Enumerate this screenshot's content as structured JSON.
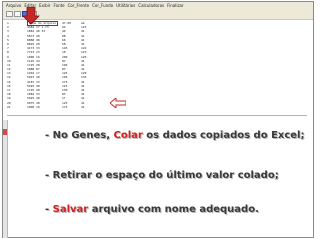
{
  "menu": [
    "Arquivo",
    "Editar",
    "Exibir",
    "Fonte",
    "Cor_Frente",
    "Cor_Fundo",
    "Utilitários",
    "Calculadoras",
    "Finalizar"
  ],
  "rows": [
    [
      "1",
      "Nome do arquivo",
      "47.00",
      "ab"
    ],
    [
      "2",
      "4382 17 1.73",
      "62",
      "123"
    ],
    [
      "3",
      "1882 40 33",
      "49",
      "41"
    ],
    [
      "4",
      "5873 40",
      "88",
      "41"
    ],
    [
      "5",
      "8888 40",
      "66",
      "41"
    ],
    [
      "6",
      "8825 28",
      "58",
      "41"
    ],
    [
      "7",
      "4173 33",
      "145",
      "122"
    ],
    [
      "8",
      "7723 23",
      "18",
      "123"
    ],
    [
      "9",
      "1000 16",
      "200",
      "126"
    ],
    [
      "10",
      "1125 44",
      "87",
      "41"
    ],
    [
      "11",
      "1725 28",
      "196",
      "41"
    ],
    [
      "12",
      "1888 87",
      "83",
      "41"
    ],
    [
      "13",
      "1204 17",
      "125",
      "120"
    ],
    [
      "14",
      "5923 40",
      "196",
      "135"
    ],
    [
      "15",
      "4187 33",
      "175",
      "41"
    ],
    [
      "16",
      "5925 40",
      "125",
      "41"
    ],
    [
      "17",
      "1725 28",
      "130",
      "41"
    ],
    [
      "18",
      "1882 33",
      "83",
      "41"
    ],
    [
      "19",
      "5925 40",
      "17",
      "41"
    ],
    [
      "20",
      "9975 40",
      "125",
      "41"
    ],
    [
      "21",
      "1000 16",
      "175",
      "41"
    ]
  ],
  "instructions": {
    "line1_pre": "- No Genes, ",
    "line1_hl": "Colar",
    "line1_post": " os dados copiados do Excel;",
    "line2": "- Retirar o espaço do último valor colado;",
    "line3_pre": "- ",
    "line3_hl": "Salvar",
    "line3_post": " arquivo com nome adequado."
  },
  "colors": {
    "highlight": "#d92020",
    "arrow": "#c62828",
    "text": "#3a3a3a"
  },
  "icons": [
    "arrow-down-icon",
    "arrow-left-icon"
  ]
}
